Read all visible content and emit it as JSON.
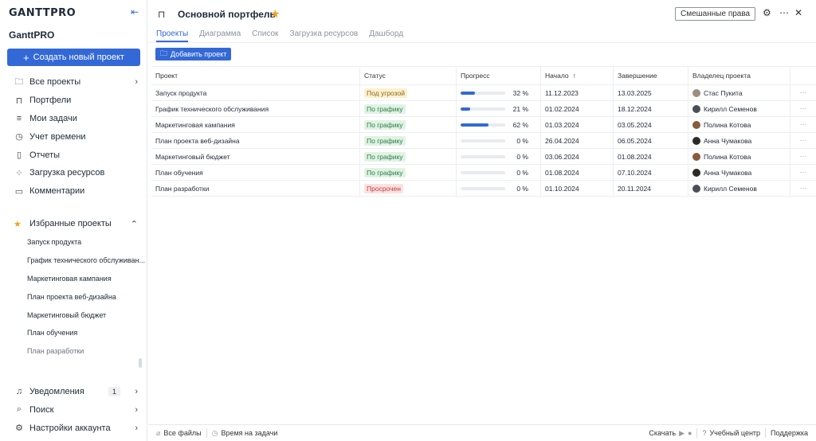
{
  "sidebar": {
    "logo": "GANTTPRO",
    "collapse_icon": "collapse-left-icon",
    "workspace": "GanttPRO",
    "create_button": "Создать новый проект",
    "nav": [
      {
        "label": "Все проекты",
        "icon": "folder-icon"
      },
      {
        "label": "Портфели",
        "icon": "briefcase-icon"
      },
      {
        "label": "Мои задачи",
        "icon": "list-icon"
      },
      {
        "label": "Учет времени",
        "icon": "clock-icon"
      },
      {
        "label": "Отчеты",
        "icon": "report-icon"
      },
      {
        "label": "Загрузка ресурсов",
        "icon": "grid-icon"
      },
      {
        "label": "Комментарии",
        "icon": "comment-icon"
      }
    ],
    "favorites_title": "Избранные проекты",
    "favorites": [
      "Запуск продукта",
      "График технического обслуживан...",
      "Маркетинговая кампания",
      "План проекта веб-дизайна",
      "Маркетинговый бюджет",
      "План обучения",
      "План разработки"
    ],
    "bottom": [
      {
        "label": "Уведомления",
        "icon": "bell-icon",
        "badge": "1"
      },
      {
        "label": "Поиск",
        "icon": "search-icon"
      },
      {
        "label": "Настройки аккаунта",
        "icon": "gear-icon"
      }
    ]
  },
  "header": {
    "title": "Основной портфель",
    "mixed_rights": "Смешанные права"
  },
  "tabs": [
    "Проекты",
    "Диаграмма",
    "Список",
    "Загрузка ресурсов",
    "Дашборд"
  ],
  "add_project": "Добавить проект",
  "table": {
    "columns": [
      "Проект",
      "Статус",
      "Прогресс",
      "Начало",
      "Завершение",
      "Владелец проекта"
    ],
    "rows": [
      {
        "name": "Запуск продукта",
        "status": "Под угрозой",
        "status_type": "risk",
        "progress": 32,
        "start": "11.12.2023",
        "end": "13.03.2025",
        "owner": "Стас Пукита",
        "avatar_color": "#9c8f80"
      },
      {
        "name": "График технического обслуживания",
        "status": "По графику",
        "status_type": "ok",
        "progress": 21,
        "start": "01.02.2024",
        "end": "18.12.2024",
        "owner": "Кирилл Семенов",
        "avatar_color": "#4a4f57"
      },
      {
        "name": "Маркетинговая кампания",
        "status": "По графику",
        "status_type": "ok",
        "progress": 62,
        "start": "01.03.2024",
        "end": "03.05.2024",
        "owner": "Полина Котова",
        "avatar_color": "#8a5a3a"
      },
      {
        "name": "План проекта веб-дизайна",
        "status": "По графику",
        "status_type": "ok",
        "progress": 0,
        "start": "26.04.2024",
        "end": "06.05.2024",
        "owner": "Анна Чумакова",
        "avatar_color": "#2d2a2a"
      },
      {
        "name": "Маркетинговый бюджет",
        "status": "По графику",
        "status_type": "ok",
        "progress": 0,
        "start": "03.06.2024",
        "end": "01.08.2024",
        "owner": "Полина Котова",
        "avatar_color": "#8a5a3a"
      },
      {
        "name": "План обучения",
        "status": "По графику",
        "status_type": "ok",
        "progress": 0,
        "start": "01.08.2024",
        "end": "07.10.2024",
        "owner": "Анна Чумакова",
        "avatar_color": "#2d2a2a"
      },
      {
        "name": "План разработки",
        "status": "Просрочен",
        "status_type": "late",
        "progress": 0,
        "start": "01.10.2024",
        "end": "20.11.2024",
        "owner": "Кирилл Семенов",
        "avatar_color": "#4a4f57"
      }
    ]
  },
  "footer": {
    "all_files": "Все файлы",
    "time_on_tasks": "Время на задачи",
    "download": "Скачать",
    "learning_center": "Учебный центр",
    "support": "Поддержка"
  }
}
